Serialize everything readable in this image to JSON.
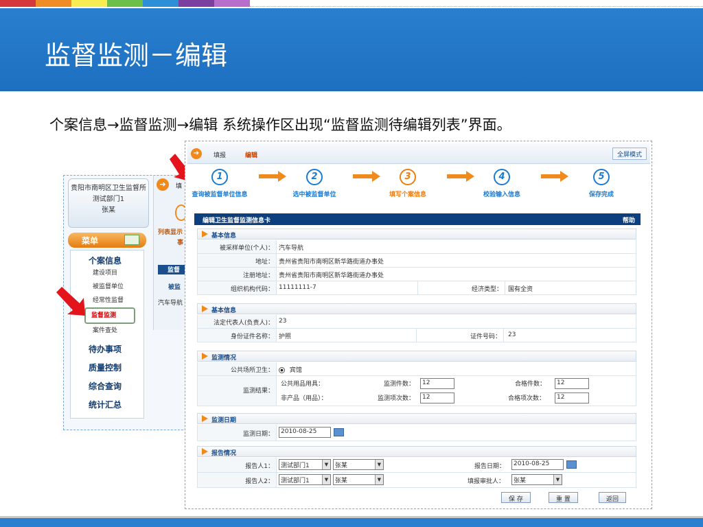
{
  "top_strip_colors": [
    "#d5383b",
    "#ef8c25",
    "#f7ec52",
    "#6cc04a",
    "#2d8fd5",
    "#7b3fa0",
    "#b86fcc",
    "#ffffff"
  ],
  "slide": {
    "title": "监督监测－编辑",
    "intro": "个案信息→监督监测→编辑    系统操作区出现“监督监测待编辑列表”界面。"
  },
  "left_panel": {
    "user_unit": "贵阳市南明区卫生监督所",
    "user_dept": "测试部门1",
    "user_name": "张某",
    "menu_label": "菜单",
    "menu": {
      "group1": "个案信息",
      "items": [
        "建设项目",
        "被监督单位",
        "经常性监督",
        "监督监测",
        "案件查处"
      ],
      "groups": [
        "待办事项",
        "质量控制",
        "综合查询",
        "统计汇总"
      ]
    },
    "side_icon": "➔",
    "side_text_1": "填",
    "side_red_1": "列表显示",
    "side_red_2": "事",
    "side_blue": "监督",
    "side_label": "被监",
    "side_row": "汽车导航"
  },
  "main_panel": {
    "toolbar": {
      "go_icon": "➔",
      "crumb1": "填报",
      "crumb2": "编辑",
      "fullscreen": "全屏模式"
    },
    "steps": [
      {
        "num": "1",
        "label": "查询被监督单位信息"
      },
      {
        "num": "2",
        "label": "选中被监督单位"
      },
      {
        "num": "3",
        "label": "填写个案信息"
      },
      {
        "num": "4",
        "label": "校验输入信息"
      },
      {
        "num": "5",
        "label": "保存完成"
      }
    ],
    "card_title": "编辑卫生监督监测信息卡",
    "help": "帮助",
    "sections": {
      "basic1": "基本信息",
      "basic2": "基本信息",
      "monitor": "监测情况",
      "date": "监测日期",
      "report": "报告情况"
    },
    "fields": {
      "sampled_unit_k": "被采样单位(个人)：",
      "sampled_unit_v": "汽车导航",
      "address_k": "地址：",
      "address_v": "贵州省贵阳市南明区新华路街道办事处",
      "reg_address_k": "注册地址：",
      "reg_address_v": "贵州省贵阳市南明区新华路街道办事处",
      "org_code_k": "组织机构代码：",
      "org_code_v": "11111111-7",
      "econ_type_k": "经济类型：",
      "econ_type_v": "国有全资",
      "legal_rep_k": "法定代表人(负责人)：",
      "legal_rep_v": "23",
      "id_type_k": "身份证件名称：",
      "id_type_v": "护照",
      "id_no_k": "证件号码：",
      "id_no_v": "23",
      "public_hygiene_k": "公共场所卫生：",
      "public_hygiene_v": "宾馆",
      "result_k": "监测结果：",
      "r1_label": "公共用品用具：",
      "r1_count_k": "监测件数：",
      "r1_count_v": "12",
      "r1_ok_k": "合格件数：",
      "r1_ok_v": "12",
      "r2_label": "非产品（用品）：",
      "r2_count_k": "监测项次数：",
      "r2_count_v": "12",
      "r2_ok_k": "合格项次数：",
      "r2_ok_v": "12",
      "monitor_date_k": "监测日期：",
      "monitor_date_v": "2010-08-25",
      "reporter1_k": "报告人1：",
      "reporter1_dept": "测试部门1",
      "reporter1_name": "张某",
      "report_date_k": "报告日期：",
      "report_date_v": "2010-08-25",
      "reporter2_k": "报告人2：",
      "reporter2_dept": "测试部门1",
      "reporter2_name": "张某",
      "approver_k": "填报审批人：",
      "approver_v": "张某"
    },
    "buttons": {
      "save": "保 存",
      "reset": "重 置",
      "back": "返回"
    }
  }
}
